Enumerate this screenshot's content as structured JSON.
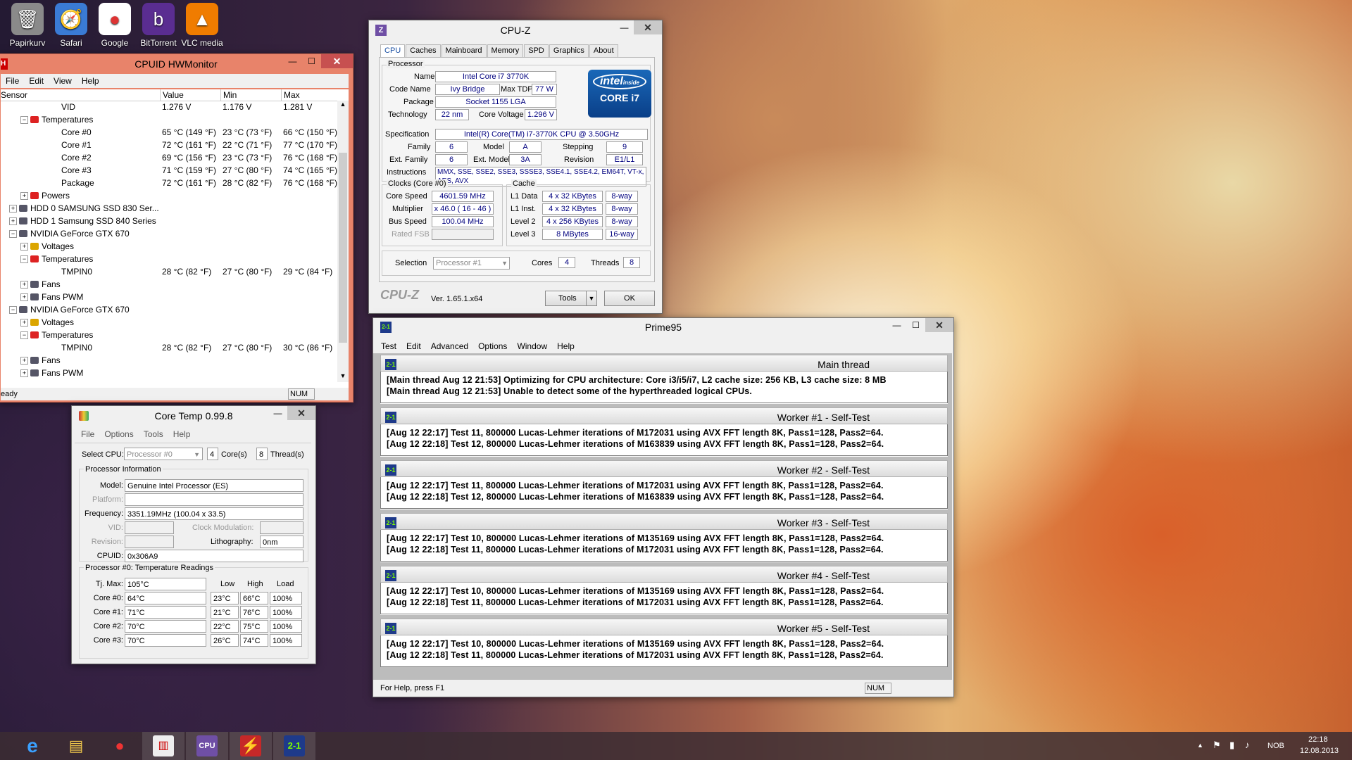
{
  "desktop_icons": [
    {
      "label": "Papirkurv",
      "icon": "recycle-bin-icon",
      "glyph": "🗑"
    },
    {
      "label": "Safari",
      "icon": "safari-icon",
      "glyph": "🧭"
    },
    {
      "label": "Google",
      "icon": "chrome-icon",
      "glyph": "●"
    },
    {
      "label": "BitTorrent",
      "icon": "bittorrent-icon",
      "glyph": "b"
    },
    {
      "label": "VLC media",
      "icon": "vlc-icon",
      "glyph": "▲"
    }
  ],
  "hwmonitor": {
    "title": "CPUID HWMonitor",
    "menu": [
      "File",
      "Edit",
      "View",
      "Help"
    ],
    "columns": [
      "Sensor",
      "Value",
      "Min",
      "Max"
    ],
    "rows": [
      {
        "name": "VID",
        "value": "1.276 V",
        "min": "1.176 V",
        "max": "1.281 V",
        "indent": 4
      },
      {
        "name": "Temperatures",
        "value": "",
        "min": "",
        "max": "",
        "indent": 2,
        "node": true
      },
      {
        "name": "Core #0",
        "value": "65 °C  (149 °F)",
        "min": "23 °C  (73 °F)",
        "max": "66 °C  (150 °F)",
        "indent": 4
      },
      {
        "name": "Core #1",
        "value": "72 °C  (161 °F)",
        "min": "22 °C  (71 °F)",
        "max": "77 °C  (170 °F)",
        "indent": 4
      },
      {
        "name": "Core #2",
        "value": "69 °C  (156 °F)",
        "min": "23 °C  (73 °F)",
        "max": "76 °C  (168 °F)",
        "indent": 4
      },
      {
        "name": "Core #3",
        "value": "71 °C  (159 °F)",
        "min": "27 °C  (80 °F)",
        "max": "74 °C  (165 °F)",
        "indent": 4
      },
      {
        "name": "Package",
        "value": "72 °C  (161 °F)",
        "min": "28 °C  (82 °F)",
        "max": "76 °C  (168 °F)",
        "indent": 4
      },
      {
        "name": "Powers",
        "value": "",
        "min": "",
        "max": "",
        "indent": 2,
        "node": true
      },
      {
        "name": "HDD 0 SAMSUNG SSD 830 Ser...",
        "value": "",
        "min": "",
        "max": "",
        "indent": 1,
        "node": true
      },
      {
        "name": "HDD 1 Samsung SSD 840 Series",
        "value": "",
        "min": "",
        "max": "",
        "indent": 1,
        "node": true
      },
      {
        "name": "NVIDIA GeForce GTX 670",
        "value": "",
        "min": "",
        "max": "",
        "indent": 1,
        "node": true
      },
      {
        "name": "Voltages",
        "value": "",
        "min": "",
        "max": "",
        "indent": 2,
        "node": true
      },
      {
        "name": "Temperatures",
        "value": "",
        "min": "",
        "max": "",
        "indent": 2,
        "node": true
      },
      {
        "name": "TMPIN0",
        "value": "28 °C  (82 °F)",
        "min": "27 °C  (80 °F)",
        "max": "29 °C  (84 °F)",
        "indent": 4
      },
      {
        "name": "Fans",
        "value": "",
        "min": "",
        "max": "",
        "indent": 2,
        "node": true
      },
      {
        "name": "Fans PWM",
        "value": "",
        "min": "",
        "max": "",
        "indent": 2,
        "node": true
      },
      {
        "name": "NVIDIA GeForce GTX 670",
        "value": "",
        "min": "",
        "max": "",
        "indent": 1,
        "node": true
      },
      {
        "name": "Voltages",
        "value": "",
        "min": "",
        "max": "",
        "indent": 2,
        "node": true
      },
      {
        "name": "Temperatures",
        "value": "",
        "min": "",
        "max": "",
        "indent": 2,
        "node": true
      },
      {
        "name": "TMPIN0",
        "value": "28 °C  (82 °F)",
        "min": "27 °C  (80 °F)",
        "max": "30 °C  (86 °F)",
        "indent": 4
      },
      {
        "name": "Fans",
        "value": "",
        "min": "",
        "max": "",
        "indent": 2,
        "node": true
      },
      {
        "name": "Fans PWM",
        "value": "",
        "min": "",
        "max": "",
        "indent": 2,
        "node": true
      }
    ],
    "status": "eady",
    "status_num": "NUM"
  },
  "cpuz": {
    "title": "CPU-Z",
    "tabs": [
      "CPU",
      "Caches",
      "Mainboard",
      "Memory",
      "SPD",
      "Graphics",
      "About"
    ],
    "processor_group": "Processor",
    "name_label": "Name",
    "name": "Intel Core i7 3770K",
    "codename_label": "Code Name",
    "codename": "Ivy Bridge",
    "maxtdp_label": "Max TDP",
    "maxtdp": "77 W",
    "package_label": "Package",
    "package": "Socket 1155 LGA",
    "tech_label": "Technology",
    "tech": "22 nm",
    "corevolt_label": "Core Voltage",
    "corevolt": "1.296 V",
    "spec_label": "Specification",
    "spec": "Intel(R) Core(TM) i7-3770K CPU @ 3.50GHz",
    "family_label": "Family",
    "family": "6",
    "model_label": "Model",
    "model": "A",
    "stepping_label": "Stepping",
    "stepping": "9",
    "extfamily_label": "Ext. Family",
    "extfamily": "6",
    "extmodel_label": "Ext. Model",
    "extmodel": "3A",
    "revision_label": "Revision",
    "revision": "E1/L1",
    "instr_label": "Instructions",
    "instr": "MMX, SSE, SSE2, SSE3, SSSE3, SSE4.1, SSE4.2, EM64T, VT-x, AES, AVX",
    "clocks_group": "Clocks (Core #0)",
    "corespeed_label": "Core Speed",
    "corespeed": "4601.59 MHz",
    "multiplier_label": "Multiplier",
    "multiplier": "x 46.0 ( 16 - 46 )",
    "busspeed_label": "Bus Speed",
    "busspeed": "100.04 MHz",
    "ratedfsb_label": "Rated FSB",
    "ratedfsb": "",
    "cache_group": "Cache",
    "l1d_label": "L1 Data",
    "l1d": "4 x 32 KBytes",
    "l1d_way": "8-way",
    "l1i_label": "L1 Inst.",
    "l1i": "4 x 32 KBytes",
    "l1i_way": "8-way",
    "l2_label": "Level 2",
    "l2": "4 x 256 KBytes",
    "l2_way": "8-way",
    "l3_label": "Level 3",
    "l3": "8 MBytes",
    "l3_way": "16-way",
    "selection_label": "Selection",
    "selection": "Processor #1",
    "cores_label": "Cores",
    "cores": "4",
    "threads_label": "Threads",
    "threads": "8",
    "logo_text": "CPU-Z",
    "version": "Ver. 1.65.1.x64",
    "tools_label": "Tools",
    "ok_label": "OK",
    "intel_brand": "intel",
    "intel_inside": "inside",
    "intel_core": "CORE i7"
  },
  "prime95": {
    "title": "Prime95",
    "menu": [
      "Test",
      "Edit",
      "Advanced",
      "Options",
      "Window",
      "Help"
    ],
    "sections": [
      {
        "title": "Main thread",
        "lines": [
          "[Main thread Aug 12 21:53] Optimizing for CPU architecture: Core i3/i5/i7, L2 cache size: 256 KB, L3 cache size: 8 MB",
          "[Main thread Aug 12 21:53] Unable to detect some of the hyperthreaded logical CPUs."
        ]
      },
      {
        "title": "Worker #1 - Self-Test",
        "lines": [
          "[Aug 12 22:17] Test 11, 800000 Lucas-Lehmer iterations of M172031 using AVX FFT length 8K, Pass1=128, Pass2=64.",
          "[Aug 12 22:18] Test 12, 800000 Lucas-Lehmer iterations of M163839 using AVX FFT length 8K, Pass1=128, Pass2=64."
        ]
      },
      {
        "title": "Worker #2 - Self-Test",
        "lines": [
          "[Aug 12 22:17] Test 11, 800000 Lucas-Lehmer iterations of M172031 using AVX FFT length 8K, Pass1=128, Pass2=64.",
          "[Aug 12 22:18] Test 12, 800000 Lucas-Lehmer iterations of M163839 using AVX FFT length 8K, Pass1=128, Pass2=64."
        ]
      },
      {
        "title": "Worker #3 - Self-Test",
        "lines": [
          "[Aug 12 22:17] Test 10, 800000 Lucas-Lehmer iterations of M135169 using AVX FFT length 8K, Pass1=128, Pass2=64.",
          "[Aug 12 22:18] Test 11, 800000 Lucas-Lehmer iterations of M172031 using AVX FFT length 8K, Pass1=128, Pass2=64."
        ]
      },
      {
        "title": "Worker #4 - Self-Test",
        "lines": [
          "[Aug 12 22:17] Test 10, 800000 Lucas-Lehmer iterations of M135169 using AVX FFT length 8K, Pass1=128, Pass2=64.",
          "[Aug 12 22:18] Test 11, 800000 Lucas-Lehmer iterations of M172031 using AVX FFT length 8K, Pass1=128, Pass2=64."
        ]
      },
      {
        "title": "Worker #5 - Self-Test",
        "lines": [
          "[Aug 12 22:17] Test 10, 800000 Lucas-Lehmer iterations of M135169 using AVX FFT length 8K, Pass1=128, Pass2=64.",
          "[Aug 12 22:18] Test 11, 800000 Lucas-Lehmer iterations of M172031 using AVX FFT length 8K, Pass1=128, Pass2=64."
        ]
      }
    ],
    "status": "For Help, press F1",
    "status_num": "NUM",
    "icon_text": "2-1"
  },
  "coretemp": {
    "title": "Core Temp 0.99.8",
    "menu": [
      "File",
      "Options",
      "Tools",
      "Help"
    ],
    "select_cpu_label": "Select CPU:",
    "select_cpu": "Processor #0",
    "cores_count": "4",
    "cores_label": "Core(s)",
    "threads_count": "8",
    "threads_label": "Thread(s)",
    "info_group": "Processor Information",
    "model_label": "Model:",
    "model": "Genuine Intel Processor (ES)",
    "platform_label": "Platform:",
    "platform": "",
    "frequency_label": "Frequency:",
    "frequency": "3351.19MHz (100.04 x 33.5)",
    "vid_label": "VID:",
    "vid": "",
    "clockmod_label": "Clock Modulation:",
    "clockmod": "",
    "revision_label": "Revision:",
    "revision": "",
    "litho_label": "Lithography:",
    "litho": "0nm",
    "cpuid_label": "CPUID:",
    "cpuid": "0x306A9",
    "temps_group": "Processor #0: Temperature Readings",
    "tjmax_label": "Tj. Max:",
    "tjmax": "105°C",
    "col_low": "Low",
    "col_high": "High",
    "col_load": "Load",
    "cores": [
      {
        "label": "Core #0:",
        "temp": "64°C",
        "low": "23°C",
        "high": "66°C",
        "load": "100%"
      },
      {
        "label": "Core #1:",
        "temp": "71°C",
        "low": "21°C",
        "high": "76°C",
        "load": "100%"
      },
      {
        "label": "Core #2:",
        "temp": "70°C",
        "low": "22°C",
        "high": "75°C",
        "load": "100%"
      },
      {
        "label": "Core #3:",
        "temp": "70°C",
        "low": "26°C",
        "high": "74°C",
        "load": "100%"
      }
    ]
  },
  "taskbar": {
    "items": [
      {
        "icon": "internet-explorer-icon",
        "glyph": "e"
      },
      {
        "icon": "file-explorer-icon",
        "glyph": "▤"
      },
      {
        "icon": "chrome-icon",
        "glyph": "●"
      },
      {
        "icon": "hwmonitor-icon",
        "glyph": "▥"
      },
      {
        "icon": "cpuz-icon",
        "glyph": "CPU"
      },
      {
        "icon": "coretemp-icon",
        "glyph": "⚡"
      },
      {
        "icon": "prime95-icon",
        "glyph": "2-1"
      }
    ],
    "lang": "NOB",
    "time": "22:18",
    "date": "12.08.2013"
  },
  "colors": {
    "hwmon_frame": "#e8836a",
    "close_red": "#c75050",
    "taskbar": "#3c2d32",
    "cpuz_value": "#00007f"
  }
}
